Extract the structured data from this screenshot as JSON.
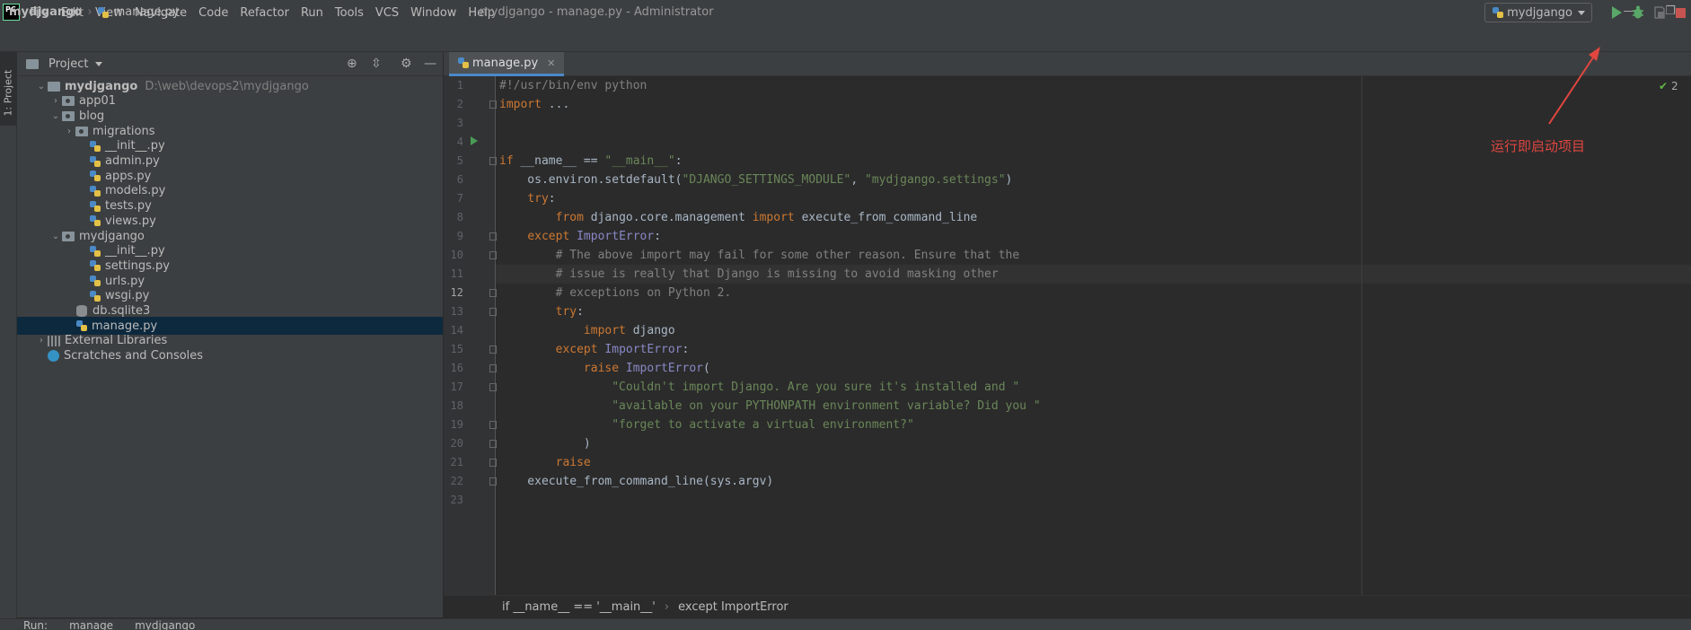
{
  "window": {
    "app_logo_text": "PC",
    "title": "mydjgango - manage.py - Administrator",
    "menu": [
      "File",
      "Edit",
      "View",
      "Navigate",
      "Code",
      "Refactor",
      "Run",
      "Tools",
      "VCS",
      "Window",
      "Help"
    ],
    "minimize": "—",
    "restore": "❐"
  },
  "navbar": {
    "project": "mydjgango",
    "separator": "›",
    "file": "manage.py",
    "run_config": "mydjgango"
  },
  "left_strip": {
    "project_tab": "1: Project"
  },
  "project_panel": {
    "title": "Project",
    "tree": [
      {
        "label": "mydjgango",
        "path": "D:\\web\\devops2\\mydjgango",
        "type": "folder-root",
        "level": 0,
        "expanded": true
      },
      {
        "label": "app01",
        "type": "folder",
        "level": 1,
        "expanded": false
      },
      {
        "label": "blog",
        "type": "folder",
        "level": 1,
        "expanded": true
      },
      {
        "label": "migrations",
        "type": "folder",
        "level": 2,
        "expanded": false
      },
      {
        "label": "__init__.py",
        "type": "py",
        "level": 3
      },
      {
        "label": "admin.py",
        "type": "py",
        "level": 3
      },
      {
        "label": "apps.py",
        "type": "py",
        "level": 3
      },
      {
        "label": "models.py",
        "type": "py",
        "level": 3
      },
      {
        "label": "tests.py",
        "type": "py",
        "level": 3
      },
      {
        "label": "views.py",
        "type": "py",
        "level": 3
      },
      {
        "label": "mydjgango",
        "type": "folder",
        "level": 1,
        "expanded": true
      },
      {
        "label": "__init__.py",
        "type": "py",
        "level": 3
      },
      {
        "label": "settings.py",
        "type": "py",
        "level": 3
      },
      {
        "label": "urls.py",
        "type": "py",
        "level": 3
      },
      {
        "label": "wsgi.py",
        "type": "py",
        "level": 3
      },
      {
        "label": "db.sqlite3",
        "type": "db",
        "level": 2
      },
      {
        "label": "manage.py",
        "type": "py",
        "level": 2,
        "selected": true
      },
      {
        "label": "External Libraries",
        "type": "lib",
        "level": 0,
        "expanded": false
      },
      {
        "label": "Scratches and Consoles",
        "type": "scratch",
        "level": 0
      }
    ]
  },
  "editor": {
    "tab": "manage.py",
    "inspection_count": "2",
    "current_line": 12,
    "lines": [
      "#!/usr/bin/env python",
      "import ...",
      "",
      "",
      "if __name__ == \"__main__\":",
      "    os.environ.setdefault(\"DJANGO_SETTINGS_MODULE\", \"mydjgango.settings\")",
      "    try:",
      "        from django.core.management import execute_from_command_line",
      "    except ImportError:",
      "        # The above import may fail for some other reason. Ensure that the",
      "        # issue is really that Django is missing to avoid masking other",
      "        # exceptions on Python 2.",
      "        try:",
      "            import django",
      "        except ImportError:",
      "            raise ImportError(",
      "                \"Couldn't import Django. Are you sure it's installed and \"",
      "                \"available on your PYTHONPATH environment variable? Did you \"",
      "                \"forget to activate a virtual environment?\"",
      "            )",
      "        raise",
      "    execute_from_command_line(sys.argv)",
      ""
    ]
  },
  "annotation": {
    "text": "运行即启动项目",
    "color": "#e0463f"
  },
  "breadcrumb_bottom": [
    "if __name__ == '__main__'",
    "except ImportError"
  ],
  "run_panel": {
    "label": "Run:",
    "tabs": [
      "manage",
      "mydjgango"
    ]
  },
  "colors": {
    "accent": "#4a88c7",
    "run": "#59a869",
    "stop": "#c75450"
  }
}
